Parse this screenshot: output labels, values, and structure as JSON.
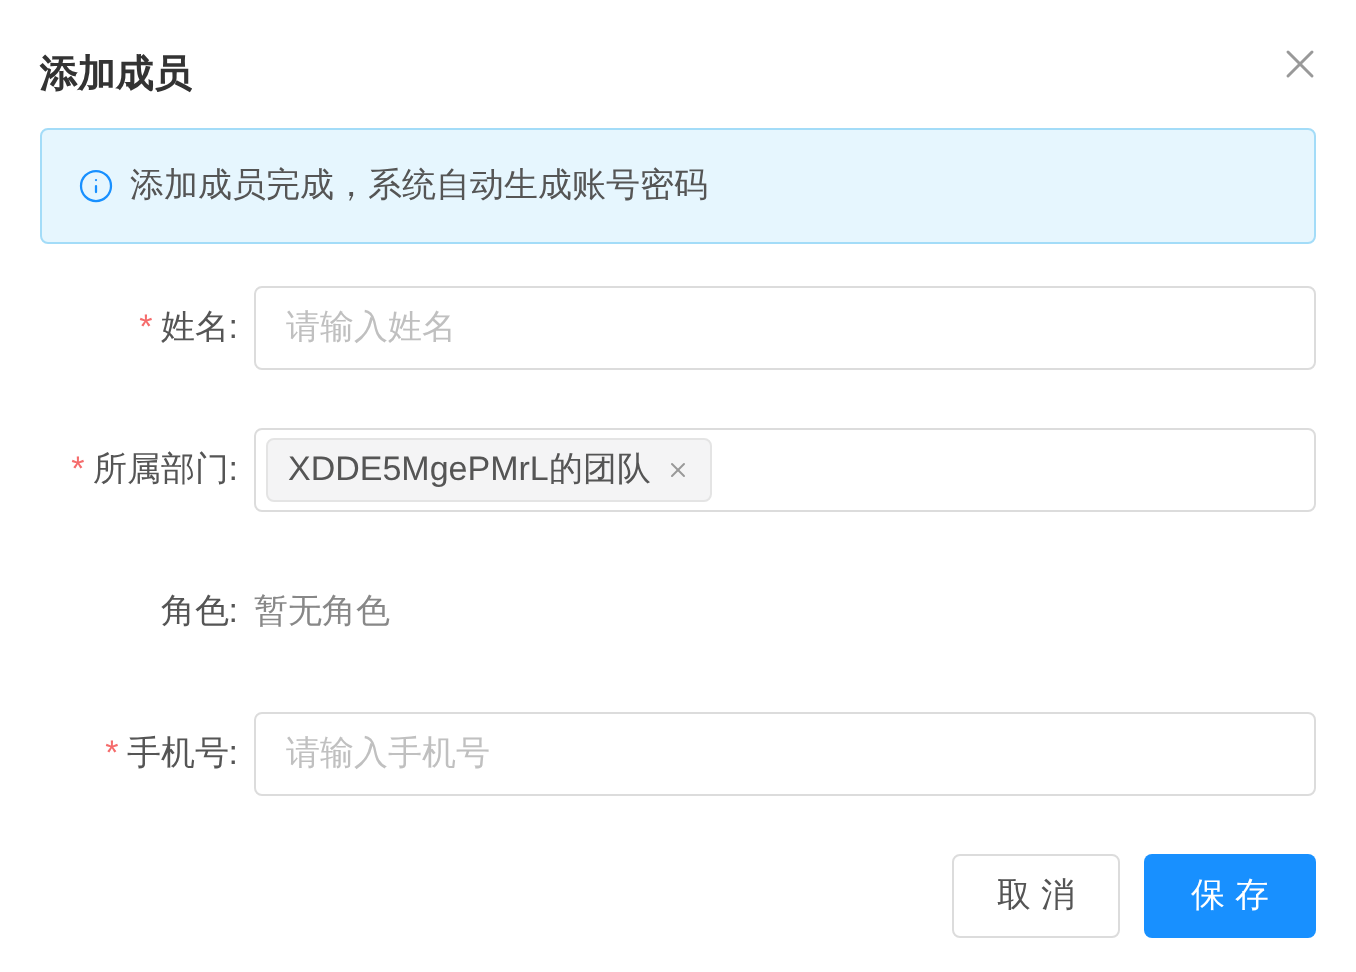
{
  "dialog": {
    "title": "添加成员",
    "alert": "添加成员完成，系统自动生成账号密码",
    "fields": [
      {
        "kind": "input",
        "label": "姓名:",
        "required_mark": "*",
        "placeholder": "请输入姓名"
      },
      {
        "kind": "tags",
        "label": "所属部门:",
        "required_mark": "*",
        "tags": [
          "XDDE5MgePMrL的团队"
        ]
      },
      {
        "kind": "text",
        "label": "角色:",
        "value": "暂无角色"
      },
      {
        "kind": "input",
        "label": "手机号:",
        "required_mark": "*",
        "placeholder": "请输入手机号"
      }
    ],
    "buttons": [
      {
        "label": "取 消",
        "kind": "default"
      },
      {
        "label": "保 存",
        "kind": "primary"
      }
    ]
  }
}
